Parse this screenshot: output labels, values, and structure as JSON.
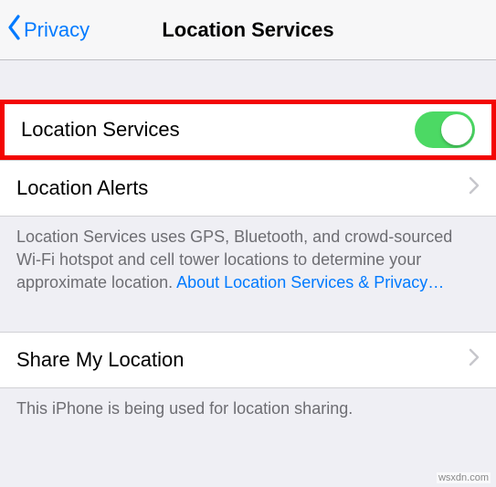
{
  "nav": {
    "back_label": "Privacy",
    "title": "Location Services"
  },
  "rows": {
    "location_services_label": "Location Services",
    "location_alerts_label": "Location Alerts",
    "share_location_label": "Share My Location"
  },
  "toggle": {
    "location_services_on": true
  },
  "footers": {
    "about_text": "Location Services uses GPS, Bluetooth, and crowd-sourced Wi-Fi hotspot and cell tower locations to determine your approximate location. ",
    "about_link": "About Location Services & Privacy…",
    "share_text": "This iPhone is being used for location sharing."
  },
  "watermark": "wsxdn.com"
}
